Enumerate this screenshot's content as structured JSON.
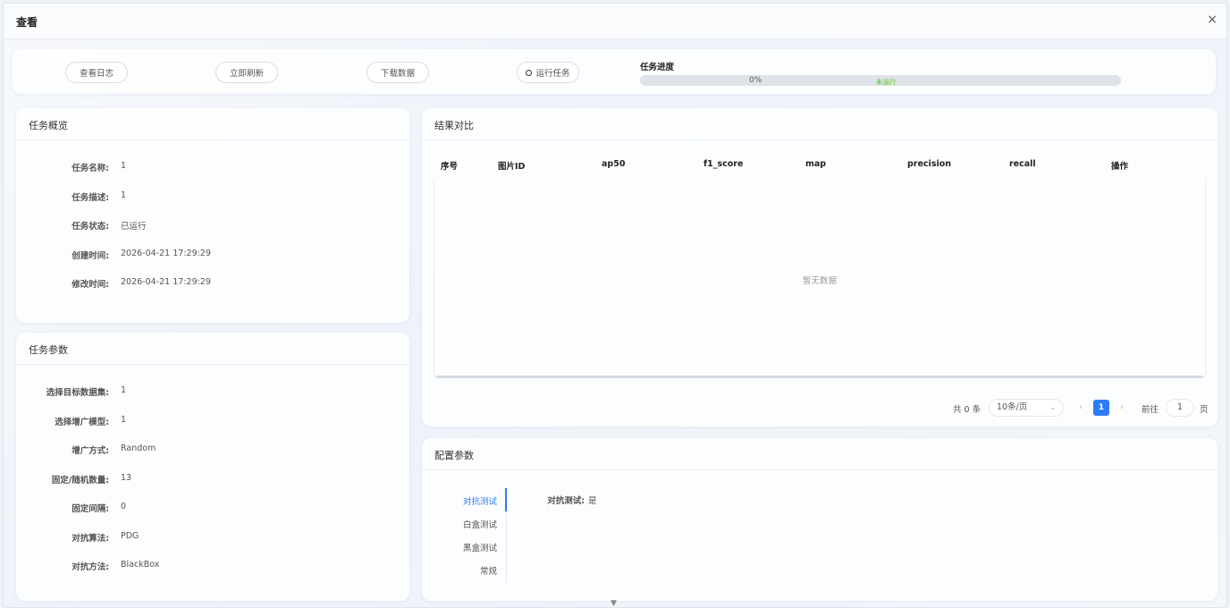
{
  "dialog": {
    "title": "查看",
    "close_label": "×"
  },
  "toolbar": {
    "view_log": "查看日志",
    "refresh": "立即刷新",
    "download": "下载数据",
    "run_task": "运行任务",
    "progress_label": "任务进度",
    "progress_percent": "0%",
    "progress_value": 0,
    "progress_status": "未运行"
  },
  "overview": {
    "title": "任务概览",
    "rows": [
      {
        "label": "任务名称:",
        "value": "1"
      },
      {
        "label": "任务描述:",
        "value": "1"
      },
      {
        "label": "任务状态:",
        "value": "已运行"
      },
      {
        "label": "创建时间:",
        "value": "2026-04-21 17:29:29"
      },
      {
        "label": "修改时间:",
        "value": "2026-04-21 17:29:29"
      }
    ]
  },
  "params": {
    "title": "任务参数",
    "rows": [
      {
        "label": "选择目标数据集:",
        "value": "1"
      },
      {
        "label": "选择增广模型:",
        "value": "1"
      },
      {
        "label": "增广方式:",
        "value": "Random"
      },
      {
        "label": "固定/随机数量:",
        "value": "13"
      },
      {
        "label": "固定间隔:",
        "value": "0"
      },
      {
        "label": "对抗算法:",
        "value": "PDG"
      },
      {
        "label": "对抗方法:",
        "value": "BlackBox"
      }
    ]
  },
  "results": {
    "title": "结果对比",
    "columns": [
      "序号",
      "图片ID",
      "ap50",
      "f1_score",
      "map",
      "precision",
      "recall",
      "操作"
    ],
    "empty_text": "暂无数据"
  },
  "pagination": {
    "total": "共 0 条",
    "page_size": "10条/页",
    "current_page": "1",
    "goto_label": "前往",
    "goto_value": "1",
    "page_suffix": "页",
    "prev": "‹",
    "next": "›",
    "chevron": "⌄"
  },
  "config": {
    "title": "配置参数",
    "tabs": [
      "对抗测试",
      "白盒测试",
      "黑盒测试",
      "常规"
    ],
    "active_tab": 0,
    "field_label": "对抗测试:",
    "field_value": "是"
  },
  "scroll_indicator": "▼"
}
